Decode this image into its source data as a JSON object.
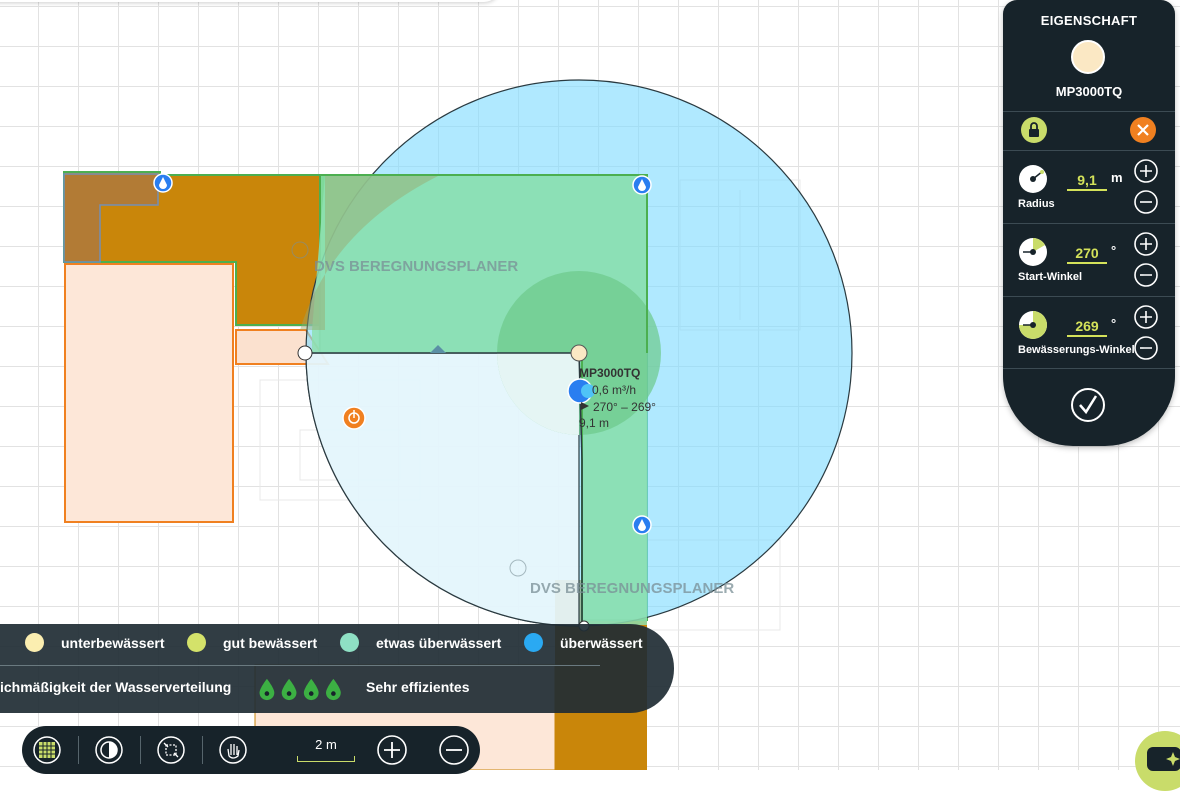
{
  "canvas": {
    "watermarks": [
      "DVS BEREGNUNGSPLANER",
      "DVS BEREGNUNGSPLANER"
    ],
    "sprinkler_label": {
      "model": "MP3000TQ",
      "flow": "0,6 m³/h",
      "angle": "270° – 269°",
      "radius": "9,1 m"
    }
  },
  "property_panel": {
    "title": "EIGENSCHAFT",
    "model": "MP3000TQ",
    "nozzle_color": "#fbe8c4",
    "radius": {
      "label": "Radius",
      "value": "9,1",
      "unit": "m"
    },
    "start_angle": {
      "label": "Start-Winkel",
      "value": "270",
      "unit": "°"
    },
    "irrigation_angle": {
      "label": "Bewässerungs-Winkel",
      "value": "269",
      "unit": "°"
    }
  },
  "legend": {
    "items": [
      {
        "label": "unterbewässert",
        "color": "#fbeeb0"
      },
      {
        "label": "gut bewässert",
        "color": "#d4e26a"
      },
      {
        "label": "etwas überwässert",
        "color": "#8fe0c4"
      },
      {
        "label": "überwässert",
        "color": "#2aa9f2"
      }
    ],
    "evenness_label": "ichmäßigkeit der Wasserverteilung",
    "efficiency_label": "Sehr effizientes",
    "efficiency_drops": 4
  },
  "toolbar": {
    "scale_label": "2 m"
  },
  "colors": {
    "panel_bg": "#17232a",
    "accent": "#c9dc6a",
    "orange": "#f08020",
    "coverage": "#7fdcff",
    "lawn": "#7fd99a",
    "bed": "#c9860a"
  }
}
